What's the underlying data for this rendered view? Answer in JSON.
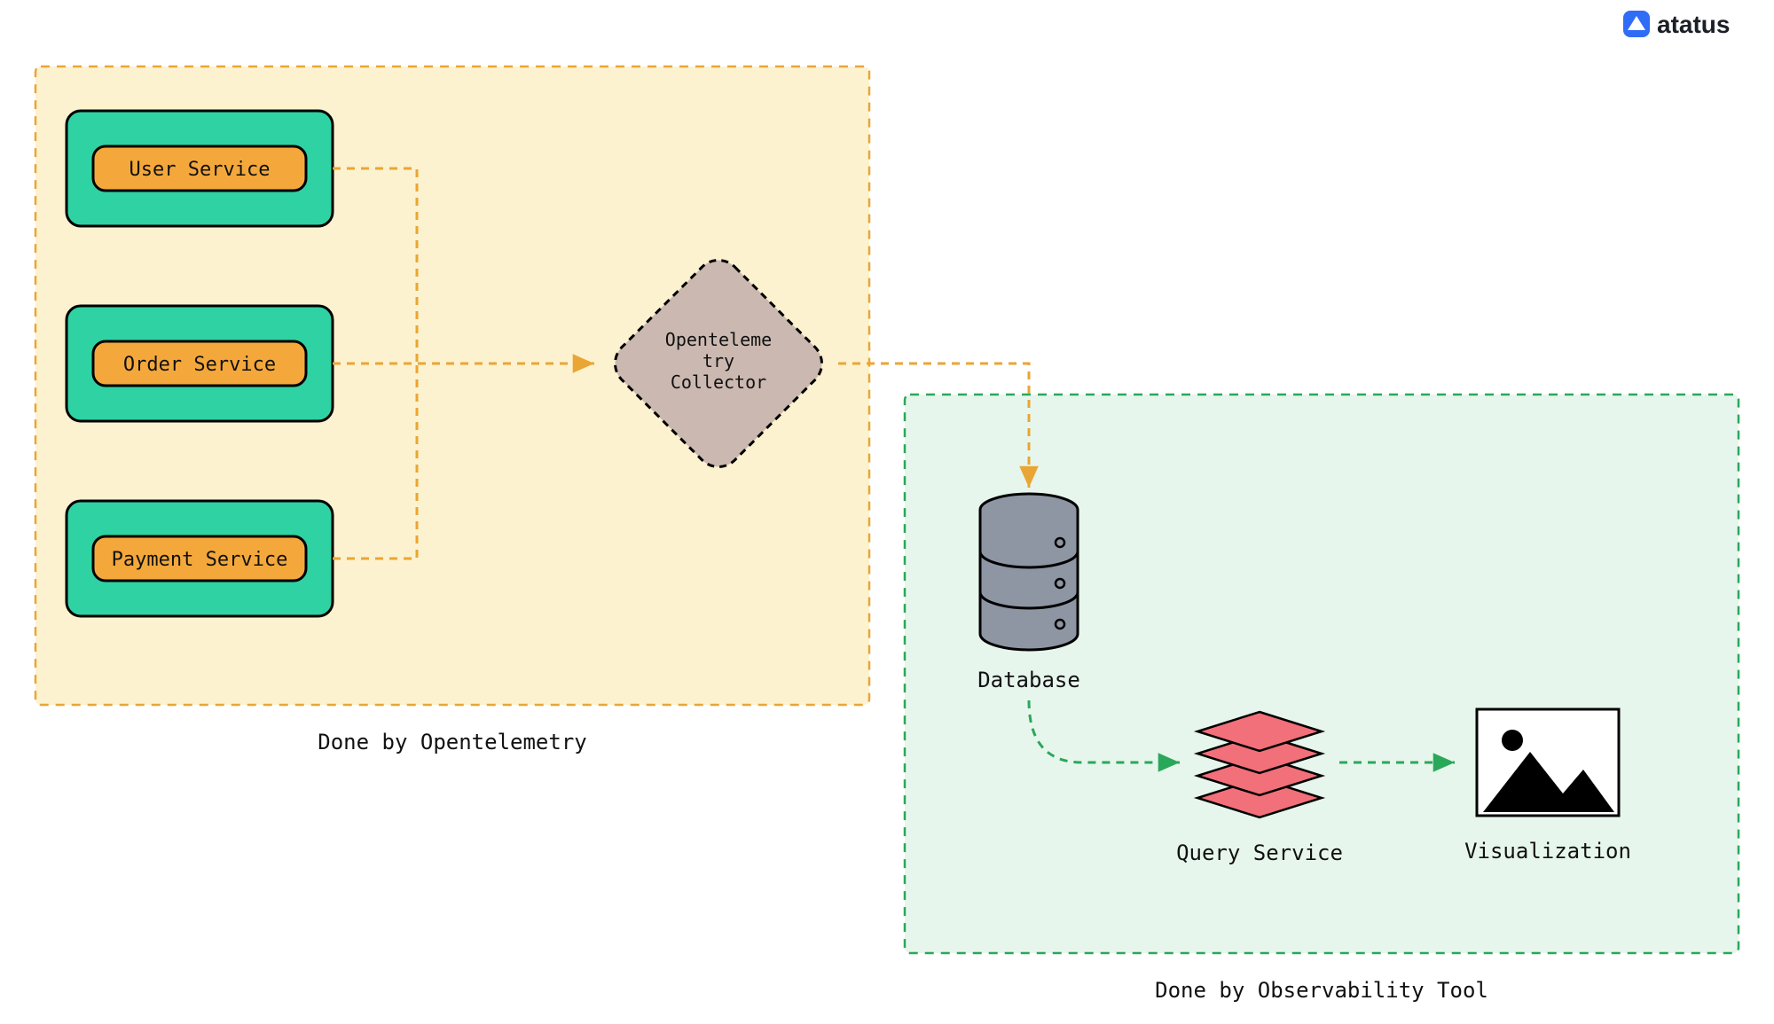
{
  "brand": {
    "name": "atatus"
  },
  "left_region": {
    "label": "Done by Opentelemetry",
    "services": [
      {
        "label": "User Service"
      },
      {
        "label": "Order Service"
      },
      {
        "label": "Payment Service"
      }
    ],
    "collector": {
      "line1": "Openteleme",
      "line2": "try",
      "line3": "Collector"
    }
  },
  "right_region": {
    "label": "Done by Observability Tool",
    "database": {
      "label": "Database"
    },
    "query": {
      "label": "Query Service"
    },
    "viz": {
      "label": "Visualization"
    }
  },
  "colors": {
    "yellow_fill": "#fcf2cf",
    "yellow_dash": "#e9a634",
    "green_fill": "#e7f6ec",
    "green_dash": "#2aa85a",
    "teal": "#2fd2a3",
    "orange": "#f4a83b",
    "diamond": "#cbb9b1",
    "grey": "#8e95a3",
    "red": "#f27079"
  }
}
